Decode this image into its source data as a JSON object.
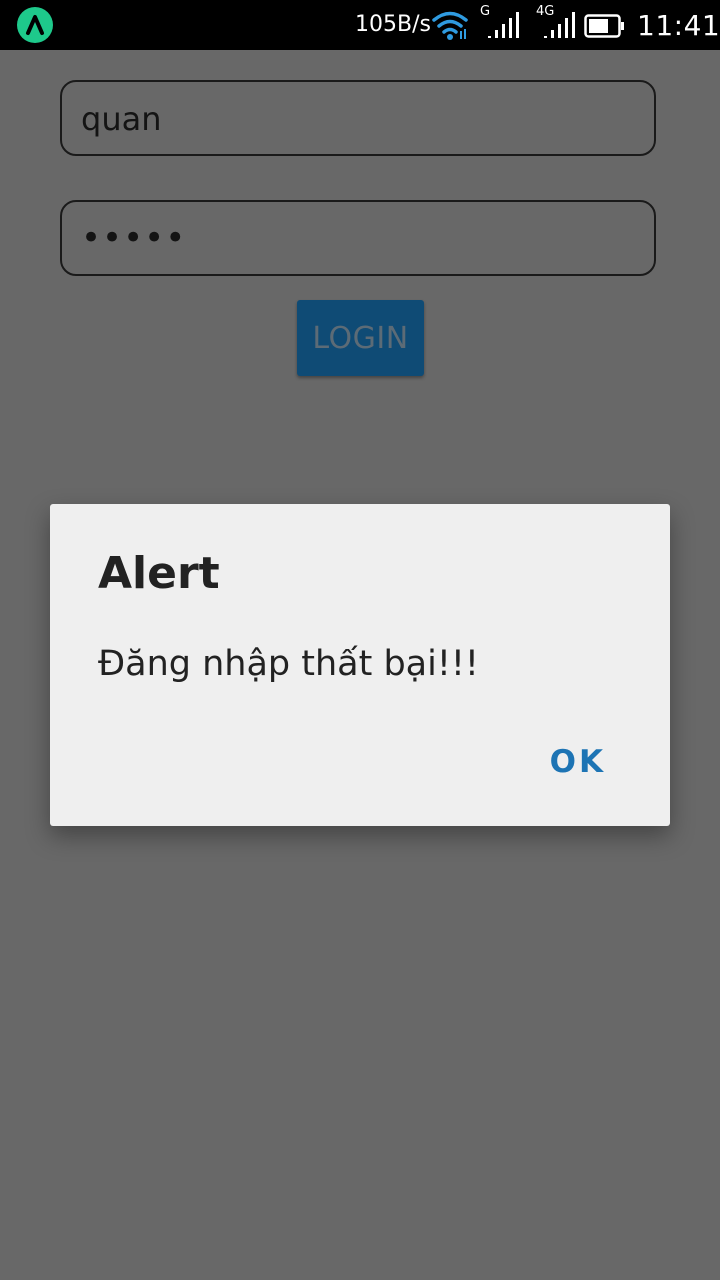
{
  "status_bar": {
    "net_speed": "105B/s",
    "signal1_label": "G",
    "signal2_label": "4G",
    "time": "11:41",
    "icons": [
      "app-badge-icon",
      "wifi-icon",
      "signal-icon",
      "signal-icon",
      "battery-icon"
    ]
  },
  "form": {
    "username_value": "quan",
    "password_value": "•••••",
    "login_label": "LOGIN"
  },
  "dialog": {
    "title": "Alert",
    "message": "Đăng nhập thất bại!!!",
    "ok_label": "OK"
  },
  "colors": {
    "background_dim": "#686868",
    "login_button": "#0f4b75",
    "dialog_bg": "#efefef",
    "ok_text": "#1d74b4",
    "badge": "#1ec98b"
  }
}
